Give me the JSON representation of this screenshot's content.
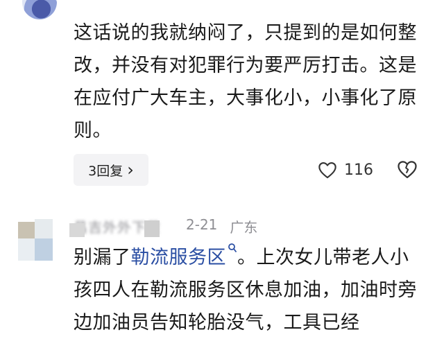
{
  "comment1": {
    "text": "这话说的我就纳闷了，只提到的是如何整改，并没有对犯罪行为要严厉打击。这是在应付广大车主，大事化小，小事化了原则。",
    "reply_label": "3回复",
    "reply_chevron": "›",
    "like_icon": "heart-outline-icon",
    "like_count": "116",
    "dislike_icon": "broken-heart-icon"
  },
  "comment2": {
    "username": "昌吉外外下黄",
    "date": "2-21",
    "location": "广东",
    "text_before": "别漏了",
    "link_text": "勒流服务区",
    "text_after": "。上次女儿带老人小孩四人在勒流服务区休息加油，加油时旁边加油员告知轮胎没气，工具已经"
  },
  "colors": {
    "link": "#2a4ea3",
    "meta_gray": "#8e8e93",
    "text": "#1a1a1a",
    "button_bg": "#f3f3f5"
  }
}
